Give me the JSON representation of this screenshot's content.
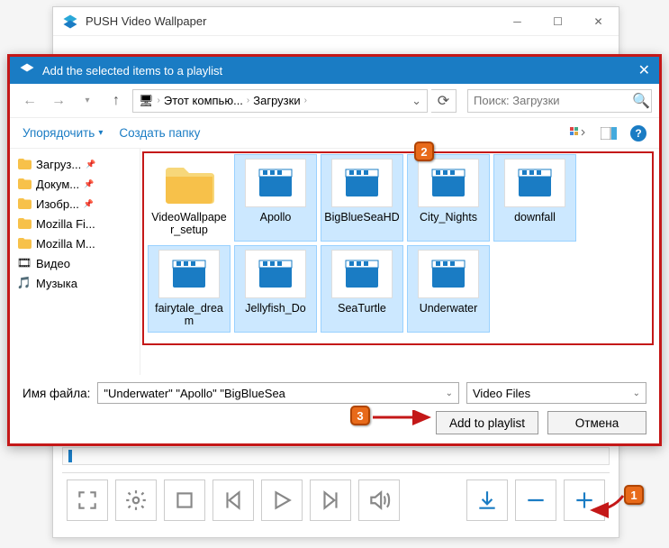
{
  "parent_window": {
    "title": "PUSH Video Wallpaper"
  },
  "dialog": {
    "title": "Add the selected items to a playlist",
    "breadcrumb": {
      "segments": [
        "Этот компью...",
        "Загрузки"
      ]
    },
    "search_placeholder": "Поиск: Загрузки",
    "toolbar": {
      "organize": "Упорядочить",
      "new_folder": "Создать папку"
    },
    "tree": [
      {
        "label": "Загруз...",
        "icon": "folder",
        "color": "#f7c14a",
        "pinned": true
      },
      {
        "label": "Докум...",
        "icon": "folder",
        "color": "#f7c14a",
        "pinned": true
      },
      {
        "label": "Изобр...",
        "icon": "folder",
        "color": "#f7c14a",
        "pinned": true
      },
      {
        "label": "Mozilla Fi...",
        "icon": "folder",
        "color": "#f7c14a",
        "pinned": false
      },
      {
        "label": "Mozilla M...",
        "icon": "folder",
        "color": "#f7c14a",
        "pinned": false
      },
      {
        "label": "Видео",
        "icon": "video",
        "color": "#2a8",
        "pinned": false
      },
      {
        "label": "Музыка",
        "icon": "music",
        "color": "#f7b500",
        "pinned": false
      }
    ],
    "files": [
      {
        "name": "VideoWallpaper_setup",
        "type": "folder",
        "selected": false
      },
      {
        "name": "Apollo",
        "type": "video",
        "selected": true
      },
      {
        "name": "BigBlueSeaHD",
        "type": "video",
        "selected": true
      },
      {
        "name": "City_Nights",
        "type": "video",
        "selected": true
      },
      {
        "name": "downfall",
        "type": "video",
        "selected": true
      },
      {
        "name": "fairytale_dream",
        "type": "video",
        "selected": true
      },
      {
        "name": "Jellyfish_Do",
        "type": "video",
        "selected": true
      },
      {
        "name": "SeaTurtle",
        "type": "video",
        "selected": true
      },
      {
        "name": "Underwater",
        "type": "video",
        "selected": true
      }
    ],
    "filename_label": "Имя файла:",
    "filename_value": "\"Underwater\" \"Apollo\" \"BigBlueSea",
    "filter_label": "Video Files",
    "add_button": "Add to playlist",
    "cancel_button": "Отмена"
  },
  "annotations": {
    "b1": "1",
    "b2": "2",
    "b3": "3"
  }
}
